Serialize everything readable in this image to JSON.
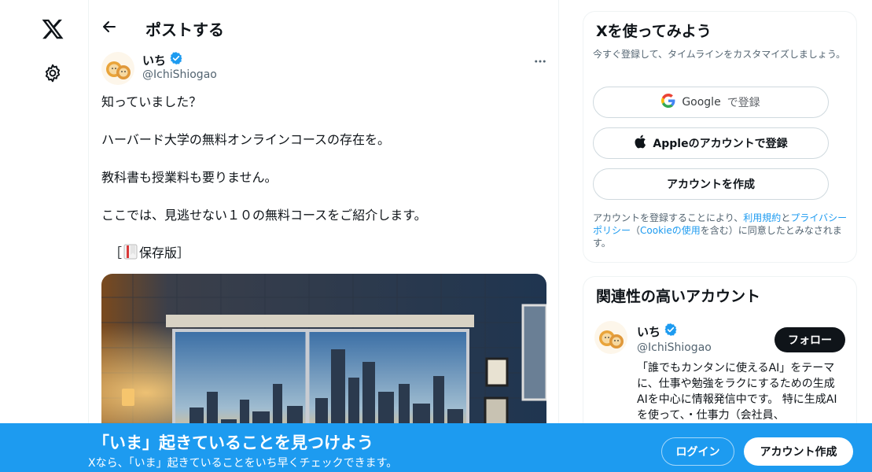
{
  "nav": {
    "logo_icon": "x-logo-icon",
    "settings_icon": "gear-icon"
  },
  "header": {
    "title": "ポストする"
  },
  "post": {
    "author_name": "いち",
    "author_handle": "@IchiShiogao",
    "verified": true,
    "paragraphs": [
      "知っていました？",
      "ハーバード大学の無料オンラインコースの存在を。",
      "教科書も授業料も要りません。",
      "ここでは、見逃せない１０の無料コースをご紹介します。"
    ],
    "last_line_prefix": "［",
    "last_line_icon": "bookmark-icon",
    "last_line_text": "保存版］"
  },
  "signup": {
    "title": "Xを使ってみよう",
    "subtitle": "今すぐ登録して、タイムラインをカスタマイズしましょう。",
    "google_brand": "Google",
    "google_rest": "で登録",
    "apple_label": "Appleのアカウントで登録",
    "create_label": "アカウントを作成",
    "legal_1": "アカウントを登録することにより、",
    "legal_terms": "利用規約",
    "legal_2": "と",
    "legal_privacy": "プライバシーポリシー",
    "legal_3": "（",
    "legal_cookie": "Cookieの使用",
    "legal_4": "を含む）に同意したとみなされます。"
  },
  "related": {
    "title": "関連性の高いアカウント",
    "name": "いち",
    "handle": "@IchiShiogao",
    "follow_label": "フォロー",
    "bio": "「誰でもカンタンに使えるAI」をテーマに、仕事や勉強をラクにするための生成AIを中心に情報発信中です。 特に生成AIを使って、・仕事力（会社員、"
  },
  "banner": {
    "title": "「いま」起きていることを見つけよう",
    "subtitle": "Xなら、「いま」起きていることをいち早くチェックできます。",
    "login_label": "ログイン",
    "signup_label": "アカウント作成"
  },
  "colors": {
    "accent": "#1d9bf0",
    "text": "#0f1419",
    "muted": "#536471"
  }
}
